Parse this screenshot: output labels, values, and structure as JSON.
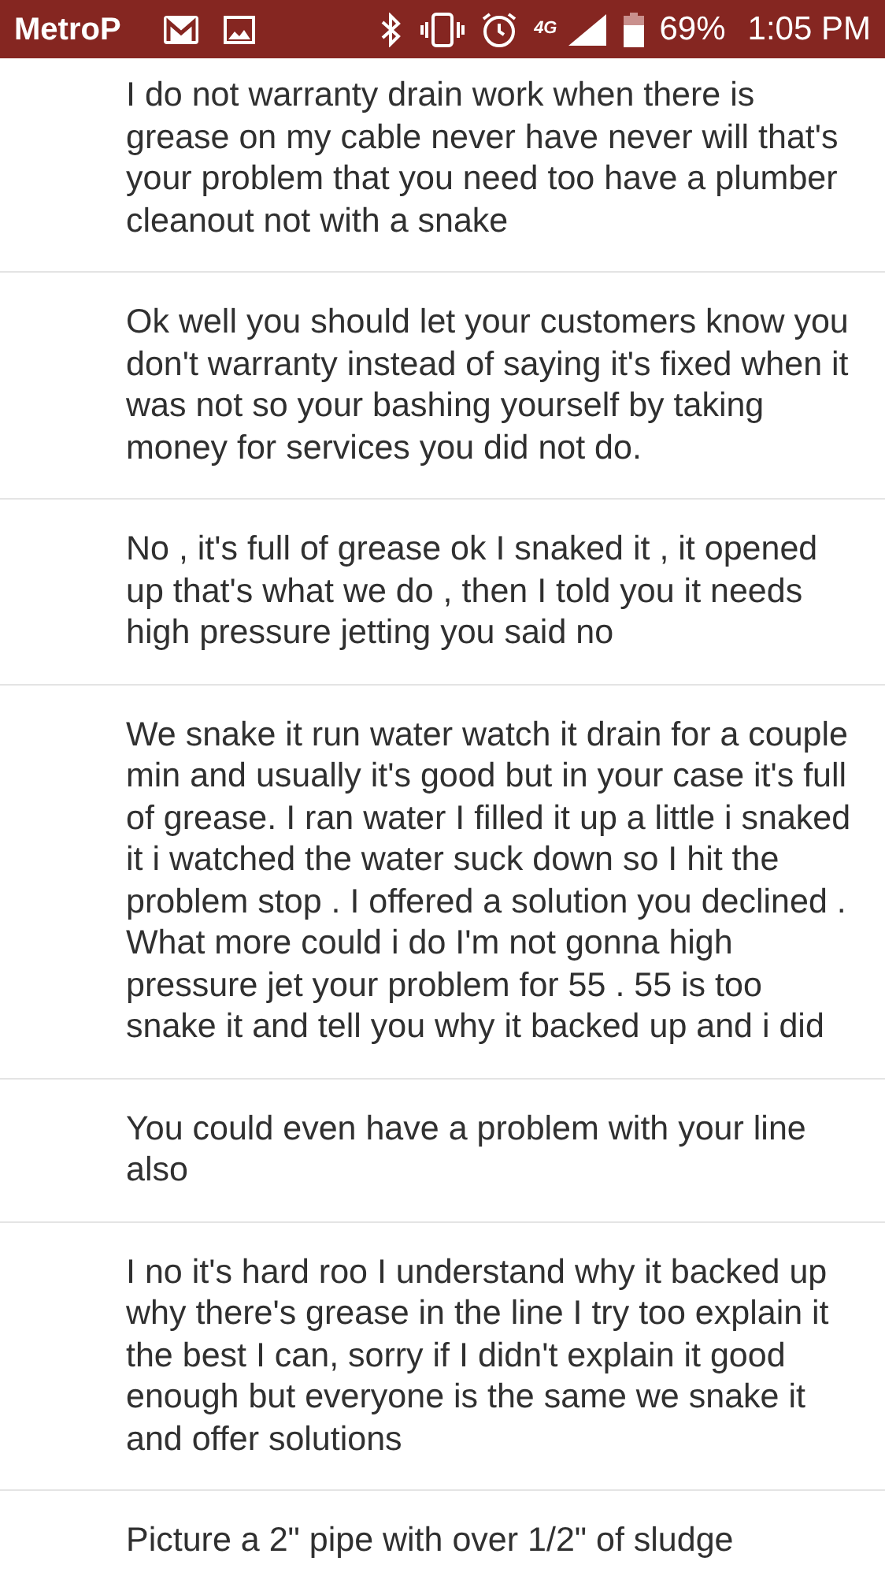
{
  "status_bar": {
    "carrier": "MetroP",
    "battery": "69%",
    "time": "1:05 PM",
    "network": "4G"
  },
  "messages": [
    {
      "text": "I do not warranty drain work when there is grease on my cable never have never will that's your problem  that you need too have a plumber cleanout not with a snake"
    },
    {
      "text": "Ok well you should let your customers know you don't warranty instead of saying it's fixed when it was not so your bashing yourself by taking money for services you did not do."
    },
    {
      "text": "No , it's full of grease ok I snaked it , it opened up that's what we do , then I told you it needs high pressure jetting you said no"
    },
    {
      "text": "We snake it run water watch it drain for a couple min and usually it's good but in your case it's full of grease.  I ran water I filled it up a little i snaked it i watched the water suck down so I hit the problem stop . I offered a solution you declined . What more could i do I'm not gonna high pressure jet your problem for 55 . 55 is too snake it and tell you why it backed up and i  did"
    },
    {
      "text": "You could even have a problem with your line also"
    },
    {
      "text": "I no it's hard roo I understand why it backed up why there's grease in the line I try too explain it the best I can,  sorry if I didn't explain it good enough but everyone is the same we snake it and offer solutions"
    },
    {
      "text": "Picture a 2\" pipe with over 1/2\" of sludge"
    }
  ]
}
